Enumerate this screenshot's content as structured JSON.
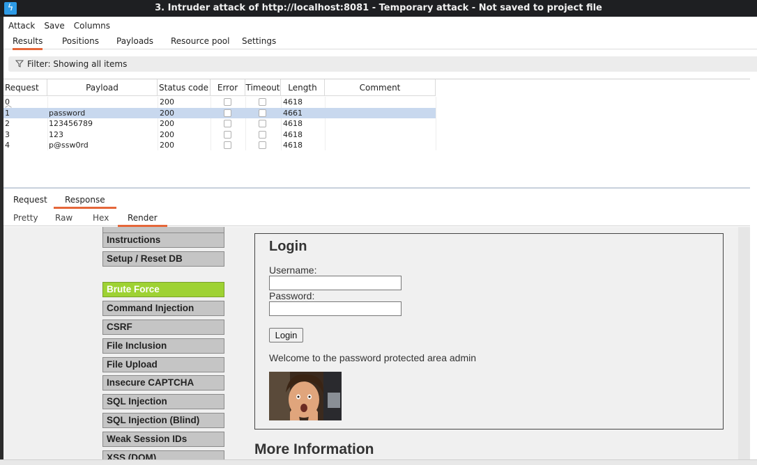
{
  "window": {
    "title": "3. Intruder attack of http://localhost:8081 - Temporary attack - Not saved to project file",
    "app_icon": "burp-lightning-icon"
  },
  "menubar": [
    "Attack",
    "Save",
    "Columns"
  ],
  "tabs": {
    "items": [
      "Results",
      "Positions",
      "Payloads",
      "Resource pool",
      "Settings"
    ],
    "active": "Results"
  },
  "filter": {
    "label": "Filter: Showing all items"
  },
  "table": {
    "columns": [
      "Request",
      "Payload",
      "Status code",
      "Error",
      "Timeout",
      "Length",
      "Comment"
    ],
    "rows": [
      {
        "request": "0",
        "payload": "",
        "status": "200",
        "error": false,
        "timeout": false,
        "length": "4618",
        "comment": ""
      },
      {
        "request": "1",
        "payload": "password",
        "status": "200",
        "error": false,
        "timeout": false,
        "length": "4661",
        "comment": "",
        "selected": true
      },
      {
        "request": "2",
        "payload": "123456789",
        "status": "200",
        "error": false,
        "timeout": false,
        "length": "4618",
        "comment": ""
      },
      {
        "request": "3",
        "payload": "123",
        "status": "200",
        "error": false,
        "timeout": false,
        "length": "4618",
        "comment": ""
      },
      {
        "request": "4",
        "payload": "p@ssw0rd",
        "status": "200",
        "error": false,
        "timeout": false,
        "length": "4618",
        "comment": ""
      }
    ]
  },
  "reqres_tabs": {
    "items": [
      "Request",
      "Response"
    ],
    "active": "Response"
  },
  "view_tabs": {
    "items": [
      "Pretty",
      "Raw",
      "Hex",
      "Render"
    ],
    "active": "Render"
  },
  "render": {
    "menu": [
      "Instructions",
      "Setup / Reset DB",
      "Brute Force",
      "Command Injection",
      "CSRF",
      "File Inclusion",
      "File Upload",
      "Insecure CAPTCHA",
      "SQL Injection",
      "SQL Injection (Blind)",
      "Weak Session IDs",
      "XSS (DOM)"
    ],
    "menu_selected": "Brute Force",
    "login": {
      "title": "Login",
      "username_label": "Username:",
      "password_label": "Password:",
      "button": "Login",
      "welcome": "Welcome to the password protected area admin"
    },
    "more_info": "More Information"
  },
  "colors": {
    "accent": "#e5673a",
    "selected_row": "#c8d8ee",
    "menu_selected": "#9ed233",
    "titlebar": "#1e1f22"
  }
}
